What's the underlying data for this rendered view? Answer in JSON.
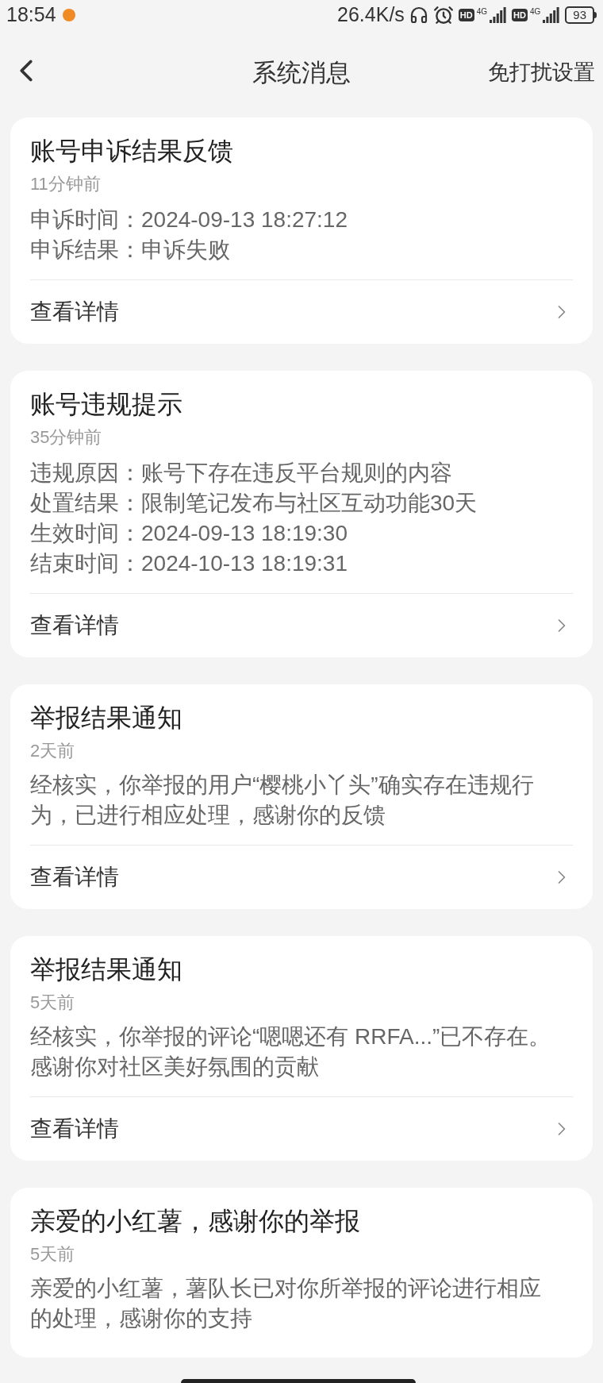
{
  "status_bar": {
    "time": "18:54",
    "speed": "26.4K/s",
    "sims": [
      {
        "hd": "HD",
        "net": "4G"
      },
      {
        "hd": "HD",
        "net": "4G"
      }
    ],
    "battery": "93"
  },
  "header": {
    "title": "系统消息",
    "action": "免打扰设置"
  },
  "messages": [
    {
      "kind": "fields",
      "title": "账号申诉结果反馈",
      "time": "11分钟前",
      "fields": [
        {
          "label": "申诉时间：",
          "value": "2024-09-13 18:27:12"
        },
        {
          "label": "申诉结果：",
          "value": "申诉失败"
        }
      ],
      "link": "查看详情"
    },
    {
      "kind": "fields",
      "title": "账号违规提示",
      "time": "35分钟前",
      "fields": [
        {
          "label": "违规原因：",
          "value": "账号下存在违反平台规则的内容"
        },
        {
          "label": "处置结果：",
          "value": "限制笔记发布与社区互动功能30天"
        },
        {
          "label": "生效时间：",
          "value": "2024-09-13 18:19:30"
        },
        {
          "label": "结束时间：",
          "value": "2024-10-13 18:19:31"
        }
      ],
      "link": "查看详情"
    },
    {
      "kind": "text",
      "title": "举报结果通知",
      "time": "2天前",
      "text": "经核实，你举报的用户“樱桃小丫头”确实存在违规行为，已进行相应处理，感谢你的反馈",
      "link": "查看详情"
    },
    {
      "kind": "text",
      "title": "举报结果通知",
      "time": "5天前",
      "text": "经核实，你举报的评论“嗯嗯还有 RRFA...”已不存在。感谢你对社区美好氛围的贡献",
      "link": "查看详情"
    },
    {
      "kind": "text",
      "title": "亲爱的小红薯，感谢你的举报",
      "time": "5天前",
      "text": "亲爱的小红薯，薯队长已对你所举报的评论进行相应的处理，感谢你的支持"
    }
  ]
}
